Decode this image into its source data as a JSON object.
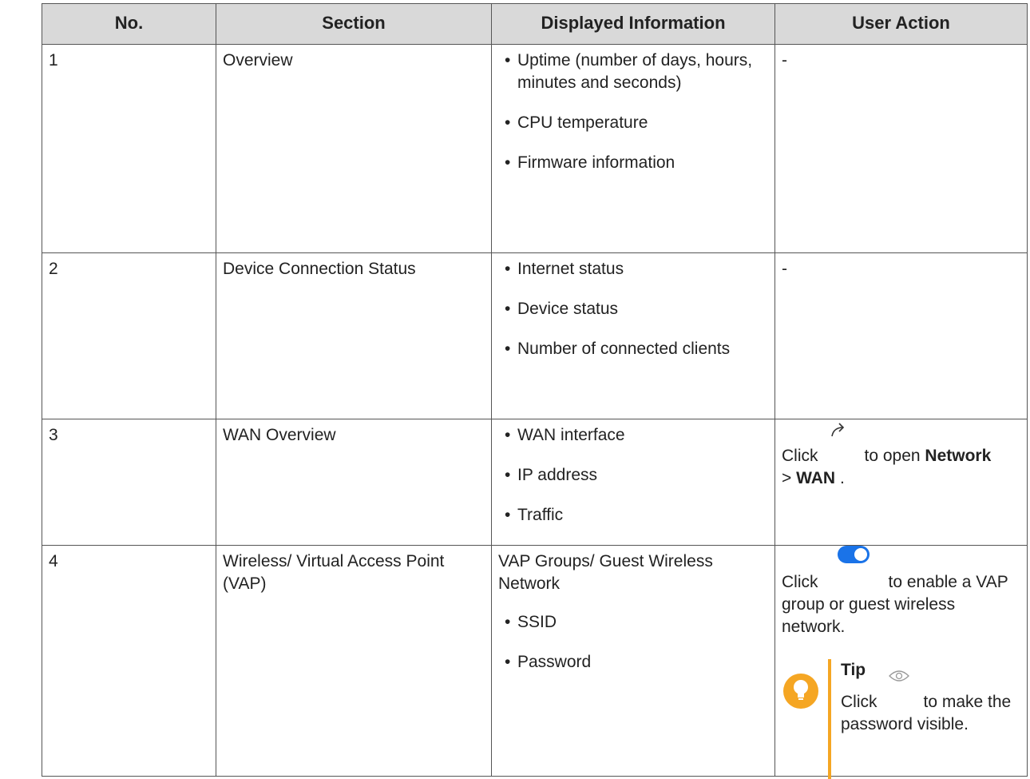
{
  "columns": [
    "No.",
    "Section",
    "Displayed Information",
    "User Action"
  ],
  "rows": [
    {
      "no": "1",
      "section": "Overview",
      "info_items": [
        "Uptime (number of days, hours, minutes and seconds)",
        "CPU temperature",
        "Firmware information"
      ],
      "action": "-"
    },
    {
      "no": "2",
      "section": "Device Connection Status",
      "info_items": [
        "Internet status",
        "Device status",
        "Number of connected clients"
      ],
      "action": "-"
    },
    {
      "no": "3",
      "section": "WAN Overview",
      "info_items": [
        "WAN interface",
        "IP address",
        "Traffic"
      ],
      "action": {
        "prefix": "Click",
        "icon": "redirect-arrow-icon",
        "middle": "to open",
        "bold1": "Network",
        "sep": ">",
        "bold2": "WAN",
        "suffix": "."
      }
    },
    {
      "no": "4",
      "section": "Wireless/ Virtual Access Point (VAP)",
      "info_intro": "VAP Groups/ Guest Wireless Network",
      "info_items": [
        "SSID",
        "Password"
      ],
      "action": {
        "prefix": "Click",
        "icon": "toggle-switch-icon",
        "text": "to enable a VAP group or guest wireless network.",
        "tip": {
          "icon": "lightbulb-icon",
          "title": "Tip",
          "prefix": "Click",
          "eye_icon": "eye-icon",
          "text": "to make the password visible."
        }
      }
    }
  ],
  "colors": {
    "header_bg": "#d9d9d9",
    "toggle_blue": "#1a73e8",
    "tip_orange": "#f5a623"
  }
}
